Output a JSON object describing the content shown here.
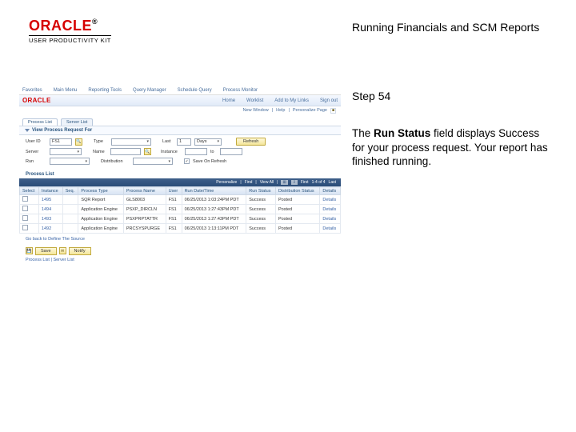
{
  "header": {
    "logo_text": "ORACLE",
    "logo_reg": "®",
    "logo_sub": "USER PRODUCTIVITY KIT",
    "title": "Running Financials and SCM Reports"
  },
  "step": {
    "label": "Step 54"
  },
  "description": {
    "pre": "The ",
    "bold": "Run Status",
    "post": " field displays Success for your process request. Your report has finished running."
  },
  "panel": {
    "nav1": [
      "Favorites",
      "Main Menu",
      "Reporting Tools",
      "Query Manager",
      "Schedule Query",
      "Process Monitor"
    ],
    "nav2": [
      "Home",
      "Worklist",
      "Add to My Links",
      "Sign out"
    ],
    "logo": "ORACLE",
    "rlinks": [
      "New Window",
      "Help",
      "Personalize Page"
    ],
    "tabs": [
      "Process List",
      "Server List"
    ],
    "section": "View Process Request For",
    "filters": {
      "user_lbl": "User ID",
      "user_val": "FS1",
      "type_lbl": "Type",
      "type_val": "",
      "last_lbl": "Last",
      "last_val": "1",
      "last_unit": "Days",
      "refresh": "Refresh",
      "server_lbl": "Server",
      "server_val": "",
      "name_lbl": "Name",
      "name_val": "",
      "instance_lbl": "Instance",
      "instance_val": "",
      "todist_lbl": "to",
      "todist_val": "",
      "run_lbl": "Run",
      "run_val": "",
      "dist_lbl": "Distribution",
      "dist_val": "",
      "save_chk_lbl": "Save On Refresh"
    },
    "list_title": "Process List",
    "tbl_bar": {
      "personalize": "Personalize",
      "find": "Find",
      "view": "View All",
      "first": "First",
      "range": "1-4 of 4",
      "last": "Last"
    },
    "columns": [
      "Select",
      "Instance",
      "Seq.",
      "Process Type",
      "Process Name",
      "User",
      "Run Date/Time",
      "Run Status",
      "Distribution Status",
      "Details"
    ],
    "rows": [
      {
        "sel": "",
        "inst": "1495",
        "seq": "",
        "ptype": "SQR Report",
        "pname": "GLS8003",
        "user": "FS1",
        "dt": "06/25/2013 1:03:24PM PDT",
        "rstat": "Success",
        "dstat": "Posted",
        "det": "Details"
      },
      {
        "sel": "",
        "inst": "1494",
        "seq": "",
        "ptype": "Application Engine",
        "pname": "PSXP_DIRCLN",
        "user": "FS1",
        "dt": "06/25/2013 1:27:43PM PDT",
        "rstat": "Success",
        "dstat": "Posted",
        "det": "Details"
      },
      {
        "sel": "",
        "inst": "1493",
        "seq": "",
        "ptype": "Application Engine",
        "pname": "PSXPRPTATTR",
        "user": "FS1",
        "dt": "06/25/2013 1:27:43PM PDT",
        "rstat": "Success",
        "dstat": "Posted",
        "det": "Details"
      },
      {
        "sel": "",
        "inst": "1492",
        "seq": "",
        "ptype": "Application Engine",
        "pname": "PRCSYSPURGE",
        "user": "FS1",
        "dt": "06/25/2013 1:13:11PM PDT",
        "rstat": "Success",
        "dstat": "Posted",
        "det": "Details"
      }
    ],
    "footer": "Go back to Define The Source",
    "save": "Save",
    "notify": "Notify",
    "tabs_bottom": "Process List | Server List"
  }
}
